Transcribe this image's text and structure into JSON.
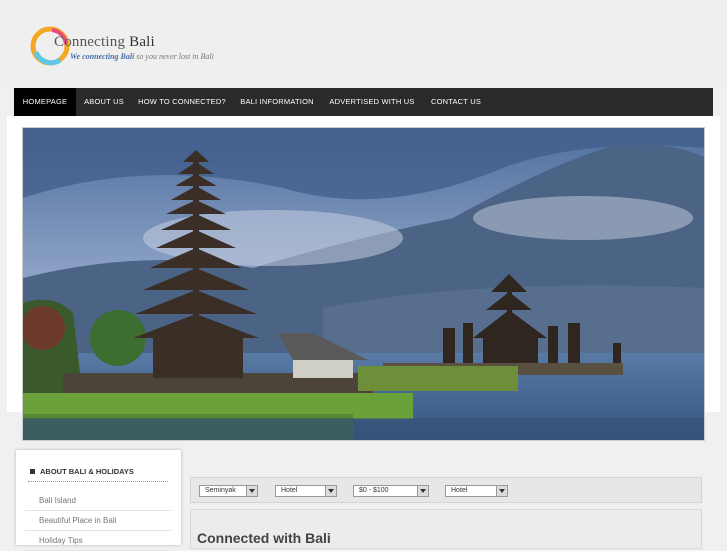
{
  "header": {
    "logo_text_light": "Connecting",
    "logo_text_bold": "Bali",
    "tagline_em": "We connecting Bali",
    "tagline_rest": "so you never lost in Bali"
  },
  "nav": {
    "items": [
      {
        "label": "HOMEPAGE",
        "active": true
      },
      {
        "label": "ABOUT US",
        "active": false
      },
      {
        "label": "HOW TO CONNECTED?",
        "active": false
      },
      {
        "label": "BALI INFORMATION",
        "active": false
      },
      {
        "label": "ADVERTISED WITH US",
        "active": false
      },
      {
        "label": "CONTACT US",
        "active": false
      }
    ]
  },
  "sidebar": {
    "title": "ABOUT BALI & HOLIDAYS",
    "links": [
      "Bali Island",
      "Beautiful Place in Bali",
      "Holiday Tips"
    ]
  },
  "filters": {
    "location": "Seminyak",
    "type": "Hotel",
    "price": "$0 - $100",
    "category": "Hotel"
  },
  "main": {
    "title": "Connected with Bali"
  },
  "colors": {
    "nav_bg": "#2a2a2a",
    "nav_active": "#000000",
    "page_bg": "#f0f0f0"
  }
}
